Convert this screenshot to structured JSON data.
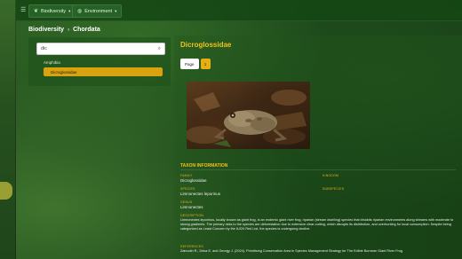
{
  "topbar": {
    "menu_icon": "menu-icon",
    "nav": [
      {
        "label": "Biodiversity",
        "icon": "leaf-icon"
      },
      {
        "label": "Environment",
        "icon": "globe-icon"
      }
    ]
  },
  "breadcrumb": {
    "root": "Biodiversity",
    "current": "Chordata"
  },
  "sidebar": {
    "search_value": "dic",
    "tree_parent": "Amphibia",
    "tree_selected": "Dicroglossidae"
  },
  "main": {
    "title": "Dicroglossidae",
    "page_label": "Page",
    "page_number": "1",
    "section_title": "TAXON INFORMATION",
    "fields": {
      "family_label": "FAMILY",
      "family_value": "Dicroglossidae",
      "species_label": "SPECIES",
      "species_value": "Limnonectes leporinus",
      "genus_label": "GENUS",
      "genus_value": "Limnonectes",
      "kingdom_label": "KINGDOM",
      "subspecies_label": "SUBSPECIES",
      "description_label": "DESCRIPTION",
      "description_value": "Limnonectes leporinus, locally known as giant frog, is an endemic giant river frog, riparian (stream dwelling) species that inhabits riparian environments along streams with moderate to strong gradients. The primary risks to the species are deforestation due to extensive clear-cutting, which disrupts its distribution, and overhunting for local consumption. Despite being categorized as Least Concern by the IUCN Red List, the species is undergoing decline.",
      "references_label": "REFERENCES",
      "references_value": "Zainudin R., Deka E. and Georgy J. (2024). Prioritising Conservation Area in Species Management Strategy for The Edible Bornean Giant River Frog"
    }
  },
  "colors": {
    "accent": "#f4c21a",
    "selected": "#d9a20f",
    "topbar": "#144614"
  }
}
